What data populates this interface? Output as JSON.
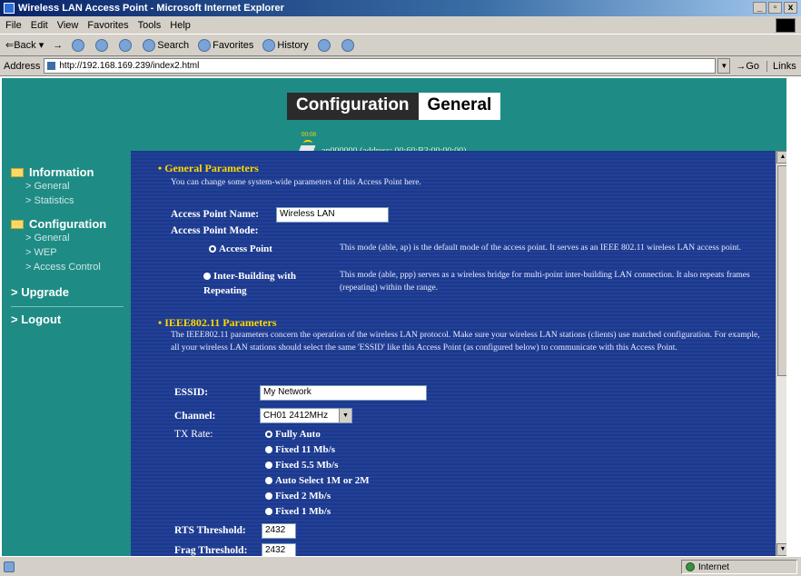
{
  "window": {
    "title": "Wireless LAN Access Point - Microsoft Internet Explorer",
    "buttons": [
      "_",
      "▫",
      "x"
    ]
  },
  "menu": [
    "File",
    "Edit",
    "View",
    "Favorites",
    "Tools",
    "Help"
  ],
  "toolbar": {
    "back": "Back",
    "forward": "→",
    "search": "Search",
    "favorites": "Favorites",
    "history": "History"
  },
  "addressbar": {
    "label": "Address",
    "url": "http://192.168.169.239/index2.html",
    "go": "Go",
    "links": "Links"
  },
  "banner": {
    "left": "Configuration",
    "right": "General"
  },
  "ap": {
    "icon_tag": "00:08",
    "line": "ap000000 (address: 00:60:B3:00:00:00)"
  },
  "sidebar": {
    "information": "Information",
    "info_items": [
      "> General",
      "> Statistics"
    ],
    "configuration": "Configuration",
    "config_items": [
      "> General",
      "> WEP",
      "> Access Control"
    ],
    "upgrade": "> Upgrade",
    "logout": "> Logout"
  },
  "general": {
    "title": "General Parameters",
    "desc": "You can change some system-wide parameters of this Access Point here.",
    "ap_name_label": "Access Point Name:",
    "ap_name_value": "Wireless LAN",
    "ap_mode_label": "Access Point Mode:",
    "mode_ap_label": "Access Point",
    "mode_ap_desc": "This mode (able, ap) is the default mode of the access point. It serves as an IEEE 802.11 wireless LAN access point.",
    "mode_ib_label": "Inter-Building with Repeating",
    "mode_ib_desc": "This mode (able, ppp) serves as a wireless bridge for multi-point inter-building LAN connection. It also repeats frames (repeating) within the range."
  },
  "ieee": {
    "title": "IEEE802.11 Parameters",
    "desc": "The IEEE802.11 parameters concern the operation of the wireless LAN protocol. Make sure your wireless LAN stations (clients) use matched configuration. For example, all your wireless LAN stations should select the same 'ESSID' like this Access Point (as configured below) to communicate with this Access Point.",
    "essid_label": "ESSID:",
    "essid_value": "My Network",
    "channel_label": "Channel:",
    "channel_value": "CH01 2412MHz",
    "txrate_label": "TX Rate:",
    "tx_options": [
      "Fully Auto",
      "Fixed 11 Mb/s",
      "Fixed 5.5 Mb/s",
      "Auto Select 1M or 2M",
      "Fixed 2 Mb/s",
      "Fixed 1 Mb/s"
    ],
    "rts_label": "RTS Threshold:",
    "rts_value": "2432",
    "frag_label": "Frag Threshold:",
    "frag_value": "2432"
  },
  "status": {
    "zone": "Internet"
  }
}
